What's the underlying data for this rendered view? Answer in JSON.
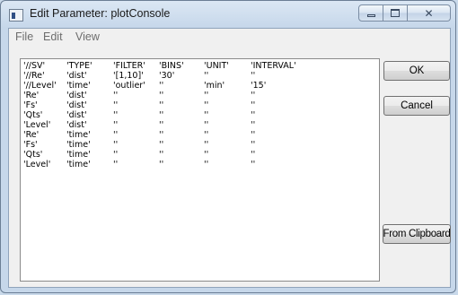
{
  "window": {
    "title": "Edit Parameter: plotConsole"
  },
  "menu": [
    "File",
    "Edit",
    "View"
  ],
  "buttons": {
    "ok": "OK",
    "cancel": "Cancel",
    "from_clipboard": "From Clipboard"
  },
  "table": {
    "rows": [
      [
        "'//SV'",
        "'TYPE'",
        "'FILTER'",
        "'BINS'",
        "'UNIT'",
        "'INTERVAL'"
      ],
      [
        "'//Re'",
        "'dist'",
        "'[1,10]'",
        "'30'",
        "''",
        "''"
      ],
      [
        "'//Level'",
        "'time'",
        "'outlier'",
        "''",
        "'min'",
        "'15'"
      ],
      [
        "'Re'",
        "'dist'",
        "''",
        "''",
        "''",
        "''"
      ],
      [
        "'Fs'",
        "'dist'",
        "''",
        "''",
        "''",
        "''"
      ],
      [
        "'Qts'",
        "'dist'",
        "''",
        "''",
        "''",
        "''"
      ],
      [
        "'Level'",
        "'dist'",
        "''",
        "''",
        "''",
        "''"
      ],
      [
        "'Re'",
        "'time'",
        "''",
        "''",
        "''",
        "''"
      ],
      [
        "'Fs'",
        "'time'",
        "''",
        "''",
        "''",
        "''"
      ],
      [
        "'Qts'",
        "'time'",
        "''",
        "''",
        "''",
        "''"
      ],
      [
        "'Level'",
        "'time'",
        "''",
        "''",
        "''",
        "''"
      ]
    ]
  },
  "icons": {
    "app": "matlab-window-icon",
    "minimize": "minimize-icon",
    "maximize": "maximize-icon",
    "close": "close-icon"
  }
}
